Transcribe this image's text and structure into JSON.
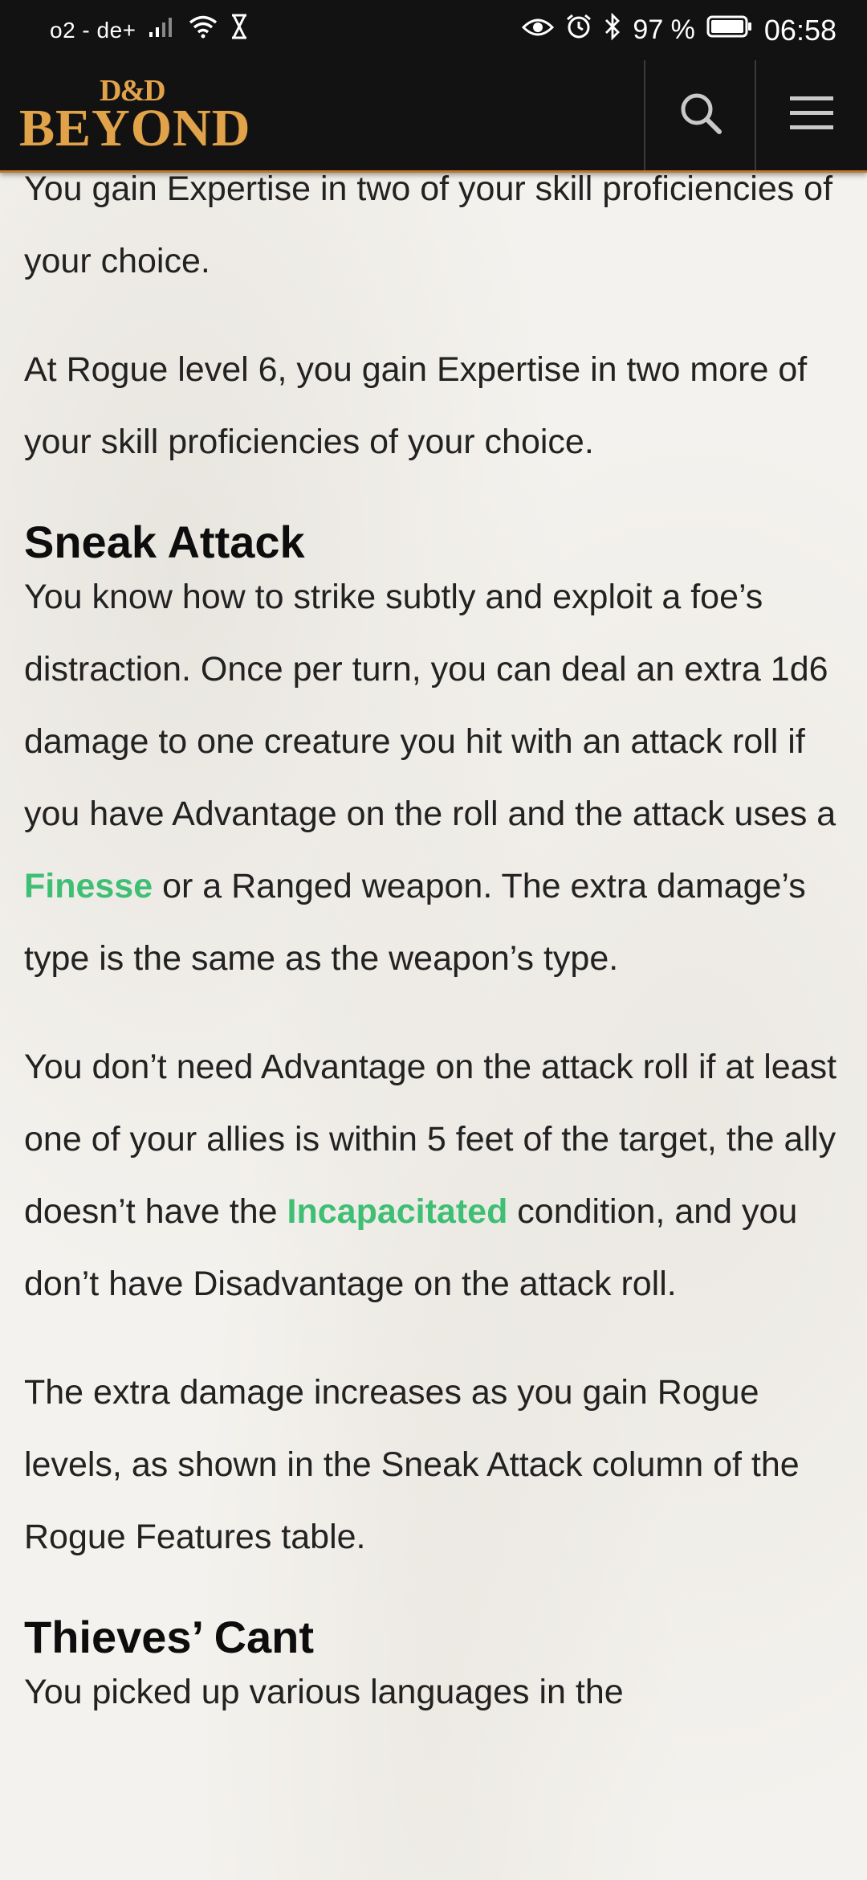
{
  "status_bar": {
    "carrier": "o2 - de+",
    "battery": "97 %",
    "time": "06:58",
    "icons": [
      "signal-icon",
      "wifi-icon",
      "hourglass-icon",
      "eye-icon",
      "alarm-icon",
      "bluetooth-icon",
      "battery-icon"
    ]
  },
  "header": {
    "logo_small": "D&D",
    "logo_big": "BEYOND",
    "accent_color": "#c2772b"
  },
  "content": {
    "p1": "You gain Expertise in two of your skill proficiencies of your choice.",
    "p2": "At Rogue level 6, you gain Expertise in two more of your skill proficiencies of your choice.",
    "h_sneak": "Sneak Attack",
    "p3_a": "You know how to strike subtly and exploit a foe’s distraction. Once per turn, you can deal an extra 1d6 damage to one creature you hit with an attack roll if you have Advantage on the roll and the attack uses a ",
    "p3_link": "Finesse",
    "p3_b": " or a Ranged weapon. The extra damage’s type is the same as the weapon’s type.",
    "p4_a": "You don’t need Advantage on the attack roll if at least one of your allies is within 5 feet of the target, the ally doesn’t have the ",
    "p4_link": "Incapacitated",
    "p4_b": " condition, and you don’t have Disadvantage on the attack roll.",
    "p5": "The extra damage increases as you gain Rogue levels, as shown in the Sneak Attack column of the Rogue Features table.",
    "h_thieves": "Thieves’ Cant",
    "p6": "You picked up various languages in the",
    "link_color": "#3fbf73"
  }
}
